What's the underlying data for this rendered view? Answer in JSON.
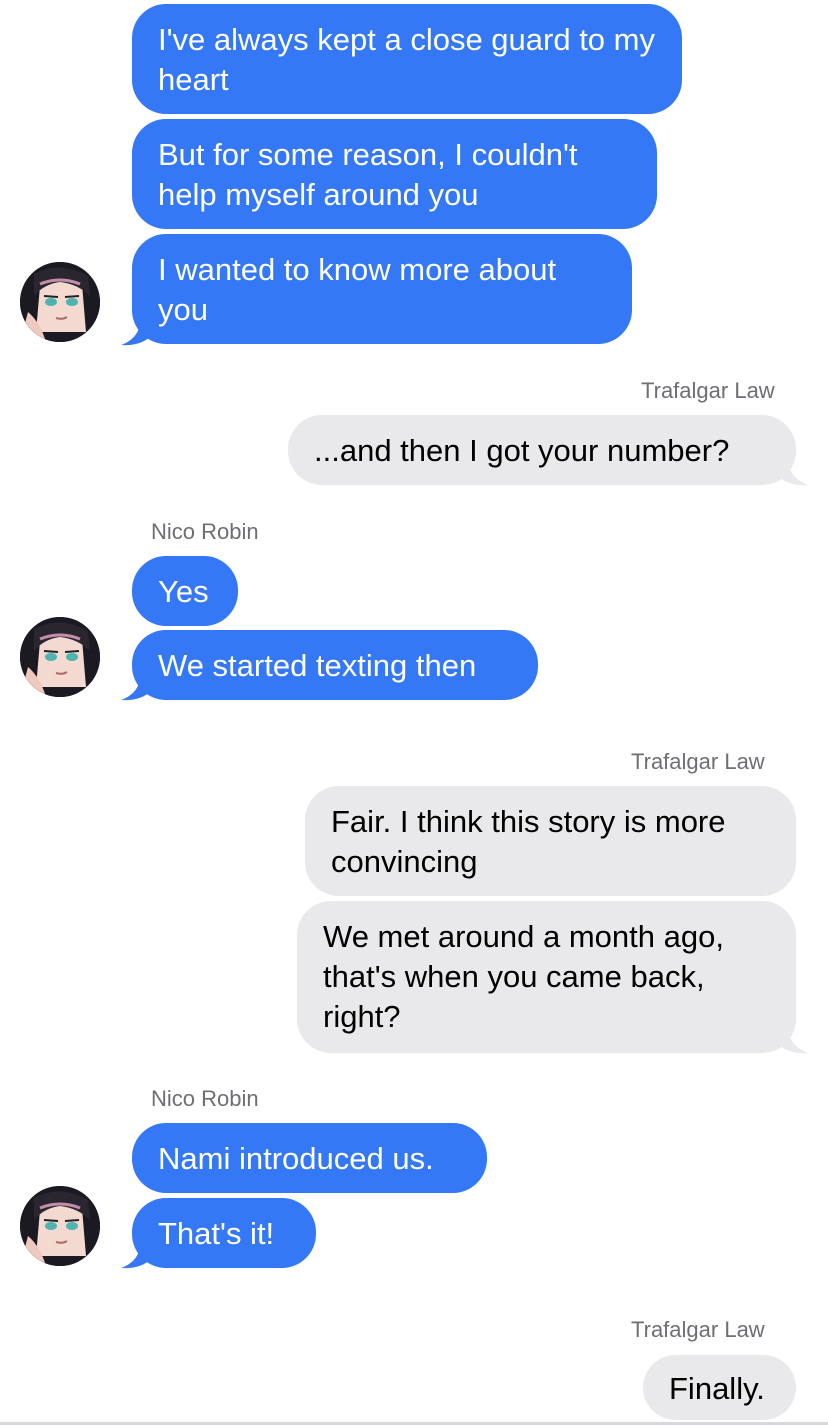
{
  "conversation": {
    "messages": [
      {
        "sender": "Nico Robin",
        "text": "I've always kept a close guard to my heart"
      },
      {
        "sender": "Nico Robin",
        "text": "But for some reason, I couldn't help myself around you"
      },
      {
        "sender": "Nico Robin",
        "text": "I wanted to know more about you"
      },
      {
        "sender": "Trafalgar Law",
        "text": "...and then I got your number?"
      },
      {
        "sender": "Nico Robin",
        "text": "Yes"
      },
      {
        "sender": "Nico Robin",
        "text": "We started texting then"
      },
      {
        "sender": "Trafalgar Law",
        "text": "Fair. I think this story is more convincing"
      },
      {
        "sender": "Trafalgar Law",
        "text": "We met around a month ago, that's when you came back, right?"
      },
      {
        "sender": "Nico Robin",
        "text": "Nami introduced us."
      },
      {
        "sender": "Nico Robin",
        "text": "That's it!"
      },
      {
        "sender": "Trafalgar Law",
        "text": "Finally."
      }
    ],
    "sender_labels": [
      "Trafalgar Law",
      "Nico Robin",
      "Trafalgar Law",
      "Nico Robin",
      "Trafalgar Law"
    ],
    "colors": {
      "blue_bubble": "#3478f6",
      "gray_bubble": "#e9e9eb",
      "sender_label": "#6e6e73"
    },
    "avatar_icon": "nico-robin-avatar-icon"
  }
}
